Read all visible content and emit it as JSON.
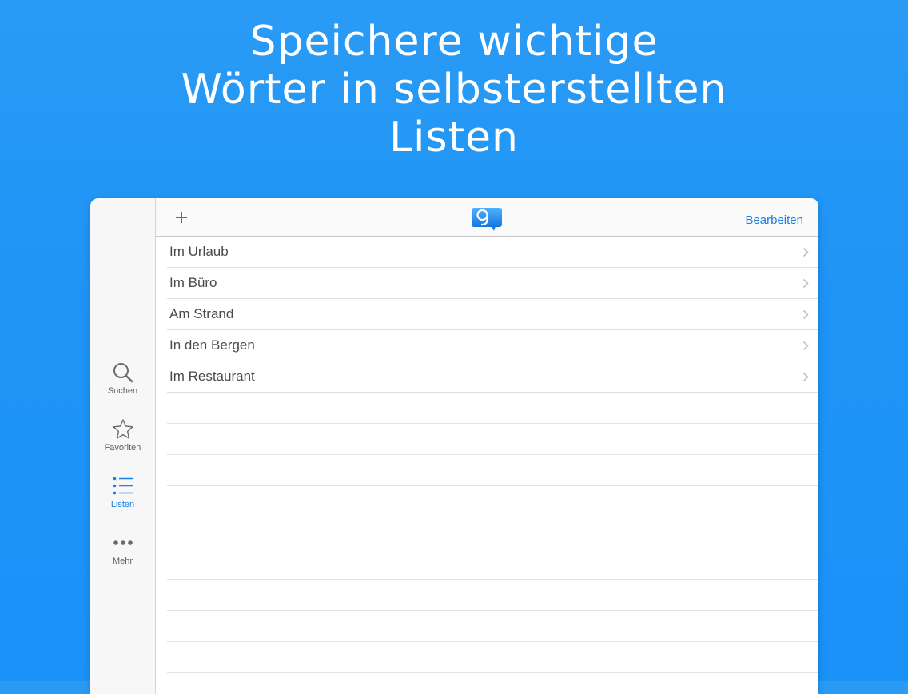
{
  "headline": {
    "line1": "Speichere wichtige",
    "line2": "Wörter in selbsterstellten",
    "line3": "Listen"
  },
  "navbar": {
    "add_icon": "plus-icon",
    "logo_icon": "speech-bubble-logo",
    "edit_label": "Bearbeiten"
  },
  "lists": {
    "items": [
      {
        "label": "Im Urlaub"
      },
      {
        "label": "Im Büro"
      },
      {
        "label": "Am Strand"
      },
      {
        "label": "In den Bergen"
      },
      {
        "label": "Im Restaurant"
      }
    ]
  },
  "sidebar": {
    "tabs": [
      {
        "label": "Suchen",
        "icon": "search-icon"
      },
      {
        "label": "Favoriten",
        "icon": "star-icon"
      },
      {
        "label": "Listen",
        "icon": "list-icon",
        "active": true
      },
      {
        "label": "Mehr",
        "icon": "more-icon"
      }
    ]
  },
  "colors": {
    "background": "#1e94f6",
    "accent": "#1a7fe6",
    "row_text": "#4a4a4a",
    "tab_text": "#5f5f5f"
  }
}
